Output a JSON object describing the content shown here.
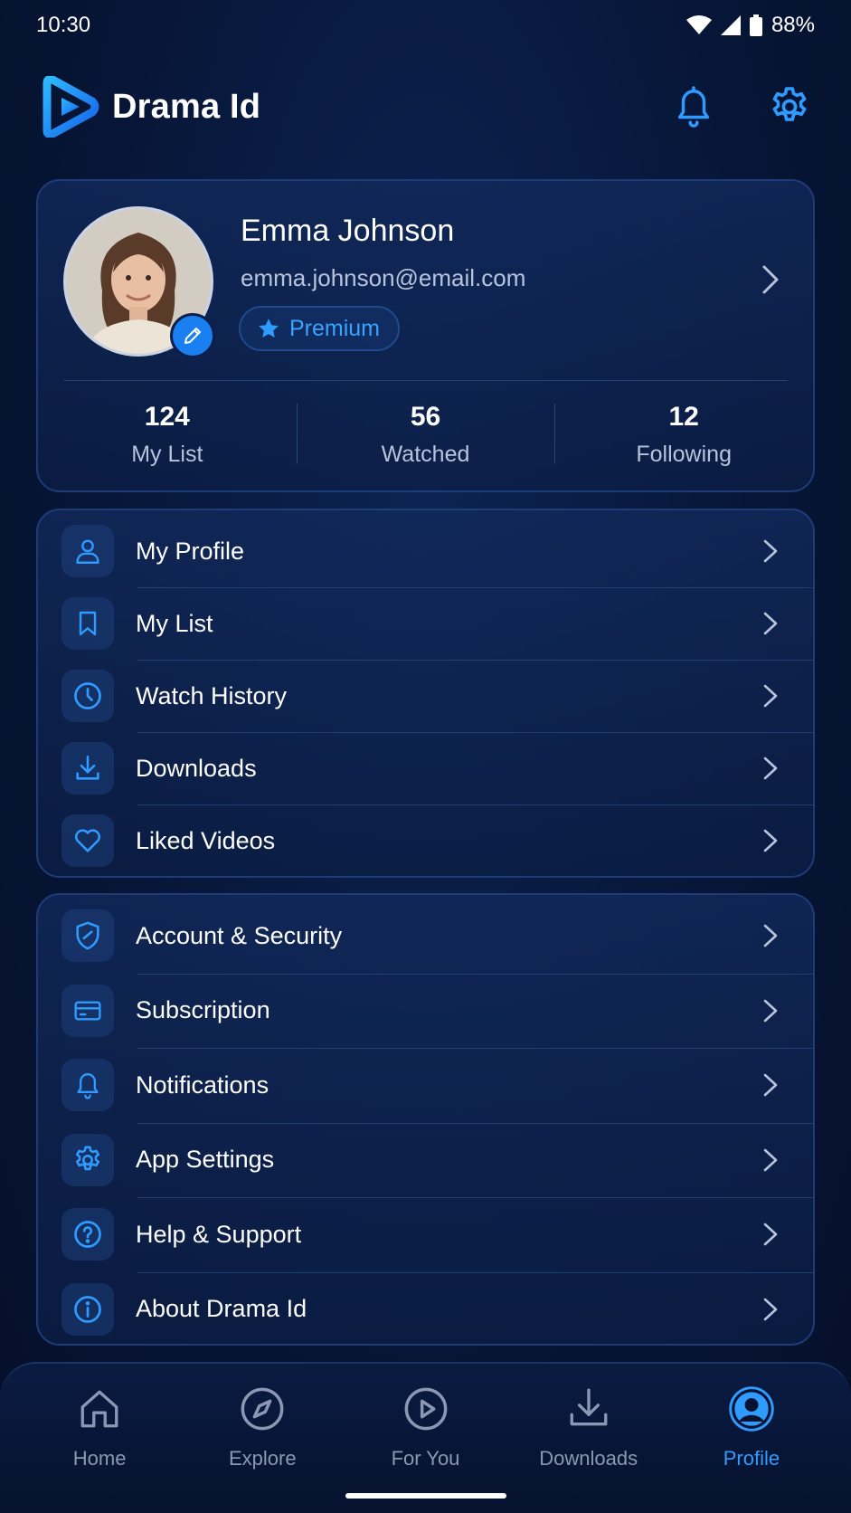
{
  "status_bar": {
    "time": "10:30",
    "battery": "88%"
  },
  "header": {
    "app_name": "Drama Id"
  },
  "profile": {
    "name": "Emma Johnson",
    "email": "emma.johnson@email.com",
    "badge": "Premium",
    "stats": [
      {
        "value": "124",
        "label": "My List"
      },
      {
        "value": "56",
        "label": "Watched"
      },
      {
        "value": "12",
        "label": "Following"
      }
    ]
  },
  "menu_group_1": [
    {
      "label": "My Profile",
      "icon": "user-icon"
    },
    {
      "label": "My List",
      "icon": "bookmark-icon"
    },
    {
      "label": "Watch History",
      "icon": "clock-icon"
    },
    {
      "label": "Downloads",
      "icon": "download-icon"
    },
    {
      "label": "Liked Videos",
      "icon": "heart-icon"
    }
  ],
  "menu_group_2": [
    {
      "label": "Account & Security",
      "icon": "shield-icon"
    },
    {
      "label": "Subscription",
      "icon": "credit-card-icon"
    },
    {
      "label": "Notifications",
      "icon": "bell-icon"
    },
    {
      "label": "App Settings",
      "icon": "gear-icon"
    },
    {
      "label": "Help & Support",
      "icon": "help-icon"
    },
    {
      "label": "About Drama Id",
      "icon": "info-icon"
    }
  ],
  "bottom_nav": [
    {
      "label": "Home",
      "icon": "home-icon"
    },
    {
      "label": "Explore",
      "icon": "compass-icon"
    },
    {
      "label": "For You",
      "icon": "play-circle-icon"
    },
    {
      "label": "Downloads",
      "icon": "download-icon"
    },
    {
      "label": "Profile",
      "icon": "profile-icon",
      "active": true
    }
  ],
  "colors": {
    "accent": "#2f9bff",
    "background": "#071637",
    "card": "#0f2756",
    "text_muted": "#b7c4dc"
  }
}
